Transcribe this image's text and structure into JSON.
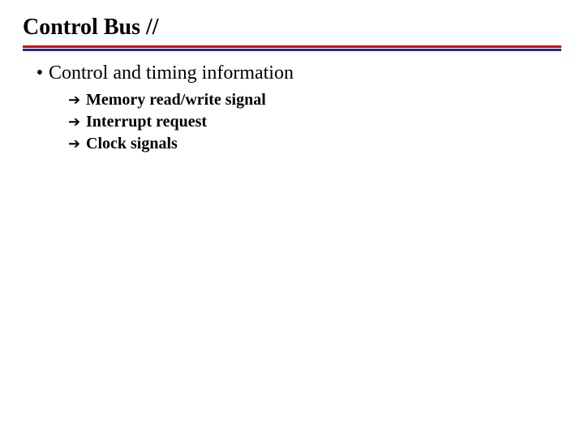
{
  "title": "Control Bus //",
  "bullet": {
    "text": "Control and timing information"
  },
  "subitems": [
    {
      "text": "Memory read/write signal"
    },
    {
      "text": "Interrupt request"
    },
    {
      "text": "Clock signals"
    }
  ]
}
